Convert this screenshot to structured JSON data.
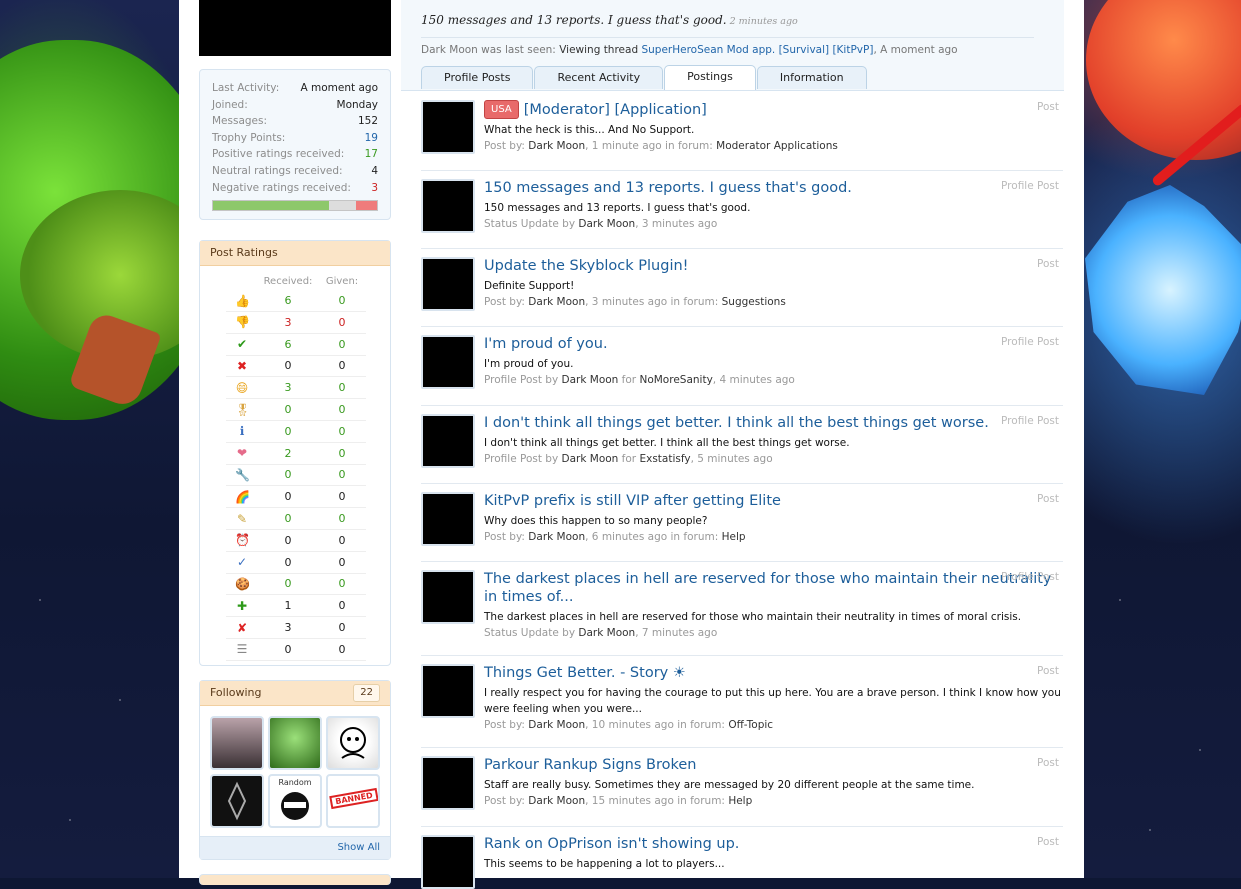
{
  "status": {
    "text": "150 messages and 13 reports. I guess that's good.",
    "ago": "2 minutes ago",
    "lastseen_prefix": "Dark Moon was last seen:",
    "lastseen_action": "Viewing thread",
    "lastseen_thread": "SuperHeroSean Mod app. [Survival] [KitPvP]",
    "lastseen_time": ", A moment ago"
  },
  "tabs": [
    "Profile Posts",
    "Recent Activity",
    "Postings",
    "Information"
  ],
  "stats": [
    {
      "k": "Last Activity:",
      "v": "A moment ago"
    },
    {
      "k": "Joined:",
      "v": "Monday"
    },
    {
      "k": "Messages:",
      "v": "152"
    },
    {
      "k": "Trophy Points:",
      "v": "19"
    },
    {
      "k": "Positive ratings received:",
      "v": "17"
    },
    {
      "k": "Neutral ratings received:",
      "v": "4"
    },
    {
      "k": "Negative ratings received:",
      "v": "3"
    }
  ],
  "rating_bar": {
    "positive": 17,
    "neutral": 4,
    "negative": 3
  },
  "post_ratings": {
    "title": "Post Ratings",
    "col_received": "Received:",
    "col_given": "Given:",
    "rows": [
      {
        "icon": "thumbs-up-icon",
        "glyph": "👍",
        "received": "6",
        "given": "0"
      },
      {
        "icon": "thumbs-down-icon",
        "glyph": "👎",
        "received": "3",
        "given": "0"
      },
      {
        "icon": "checkmark-icon",
        "glyph": "✔",
        "received": "6",
        "given": "0"
      },
      {
        "icon": "red-x-icon",
        "glyph": "✖",
        "received": "0",
        "given": "0"
      },
      {
        "icon": "funny-face-icon",
        "glyph": "😄",
        "received": "3",
        "given": "0"
      },
      {
        "icon": "award-ribbon-icon",
        "glyph": "🎖",
        "received": "0",
        "given": "0"
      },
      {
        "icon": "info-icon",
        "glyph": "ℹ",
        "received": "0",
        "given": "0"
      },
      {
        "icon": "heart-icon",
        "glyph": "❤",
        "received": "2",
        "given": "0"
      },
      {
        "icon": "wrench-icon",
        "glyph": "🔧",
        "received": "0",
        "given": "0"
      },
      {
        "icon": "rainbow-icon",
        "glyph": "🌈",
        "received": "0",
        "given": "0"
      },
      {
        "icon": "pencil-icon",
        "glyph": "✎",
        "received": "0",
        "given": "0"
      },
      {
        "icon": "alarm-clock-icon",
        "glyph": "⏰",
        "received": "0",
        "given": "0"
      },
      {
        "icon": "spellcheck-icon",
        "glyph": "✓",
        "received": "0",
        "given": "0"
      },
      {
        "icon": "cookie-icon",
        "glyph": "🍪",
        "received": "0",
        "given": "0"
      },
      {
        "icon": "green-plus-icon",
        "glyph": "✚",
        "received": "1",
        "given": "0"
      },
      {
        "icon": "red-cross-icon",
        "glyph": "✘",
        "received": "3",
        "given": "0"
      },
      {
        "icon": "hamburger-icon",
        "glyph": "☰",
        "received": "0",
        "given": "0"
      }
    ]
  },
  "following": {
    "title": "Following",
    "count": "22",
    "show_all": "Show All",
    "badge_text_1": "Random",
    "badge_text_2": "BANNED"
  },
  "postings": [
    {
      "flag": "USA",
      "title": "[Moderator] [Application]",
      "snippet": "What the heck is this... And No Support.",
      "meta_prefix": "Post by: ",
      "user": "Dark Moon",
      "meta_mid": ", 1 minute ago in forum: ",
      "target": "Moderator Applications",
      "kind": "Post"
    },
    {
      "title": "150 messages and 13 reports. I guess that's good.",
      "snippet": "150 messages and 13 reports. I guess that's good.",
      "meta_prefix": "Status Update by ",
      "user": "Dark Moon",
      "meta_mid": ", 3 minutes ago",
      "target": "",
      "kind": "Profile Post"
    },
    {
      "title": "Update the Skyblock Plugin!",
      "snippet": "Definite Support!",
      "meta_prefix": "Post by: ",
      "user": "Dark Moon",
      "meta_mid": ", 3 minutes ago in forum: ",
      "target": "Suggestions",
      "kind": "Post"
    },
    {
      "title": "I'm proud of you.",
      "snippet": "I'm proud of you.",
      "meta_prefix": "Profile Post by ",
      "user": "Dark Moon",
      "meta_mid": " for ",
      "target": "NoMoreSanity",
      "meta_end": ", 4 minutes ago",
      "kind": "Profile Post"
    },
    {
      "title": "I don't think all things get better. I think all the best things get worse.",
      "snippet": "I don't think all things get better. I think all the best things get worse.",
      "meta_prefix": "Profile Post by ",
      "user": "Dark Moon",
      "meta_mid": " for ",
      "target": "Exstatisfy",
      "meta_end": ", 5 minutes ago",
      "kind": "Profile Post"
    },
    {
      "title": "KitPvP prefix is still VIP after getting Elite",
      "snippet": "Why does this happen to so many people?",
      "meta_prefix": "Post by: ",
      "user": "Dark Moon",
      "meta_mid": ", 6 minutes ago in forum: ",
      "target": "Help",
      "kind": "Post"
    },
    {
      "title": "The darkest places in hell are reserved for those who maintain their neutrality in times of...",
      "snippet": "The darkest places in hell are reserved for those who maintain their neutrality in times of moral crisis.",
      "meta_prefix": "Status Update by ",
      "user": "Dark Moon",
      "meta_mid": ", 7 minutes ago",
      "target": "",
      "kind": "Profile Post"
    },
    {
      "title": "Things Get Better. - Story ☀",
      "snippet": "I really respect you for having the courage to put this up here. You are a brave person. I think I know how you were feeling when you were...",
      "meta_prefix": "Post by: ",
      "user": "Dark Moon",
      "meta_mid": ", 10 minutes ago in forum: ",
      "target": "Off-Topic",
      "kind": "Post"
    },
    {
      "title": "Parkour Rankup Signs Broken",
      "snippet": "Staff are really busy. Sometimes they are messaged by 20 different people at the same time.",
      "meta_prefix": "Post by: ",
      "user": "Dark Moon",
      "meta_mid": ", 15 minutes ago in forum: ",
      "target": "Help",
      "kind": "Post"
    },
    {
      "title": "Rank on OpPrison isn't showing up.",
      "snippet": "This seems to be happening a lot to players...",
      "meta_prefix": "",
      "user": "",
      "meta_mid": "",
      "target": "",
      "kind": "Post"
    }
  ]
}
